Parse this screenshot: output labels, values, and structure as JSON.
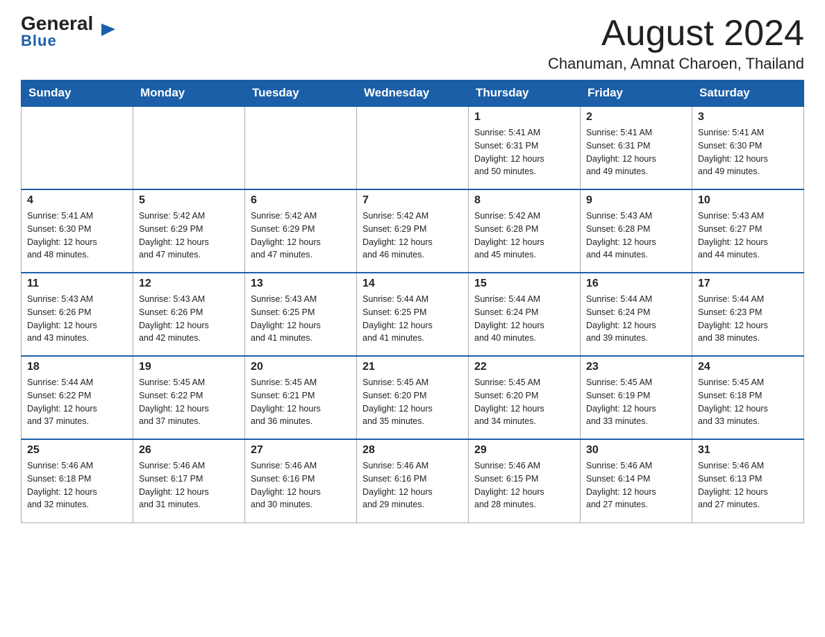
{
  "header": {
    "logo_general": "General",
    "logo_blue": "Blue",
    "month_title": "August 2024",
    "location": "Chanuman, Amnat Charoen, Thailand"
  },
  "days_of_week": [
    "Sunday",
    "Monday",
    "Tuesday",
    "Wednesday",
    "Thursday",
    "Friday",
    "Saturday"
  ],
  "weeks": [
    {
      "days": [
        {
          "date": "",
          "info": ""
        },
        {
          "date": "",
          "info": ""
        },
        {
          "date": "",
          "info": ""
        },
        {
          "date": "",
          "info": ""
        },
        {
          "date": "1",
          "info": "Sunrise: 5:41 AM\nSunset: 6:31 PM\nDaylight: 12 hours\nand 50 minutes."
        },
        {
          "date": "2",
          "info": "Sunrise: 5:41 AM\nSunset: 6:31 PM\nDaylight: 12 hours\nand 49 minutes."
        },
        {
          "date": "3",
          "info": "Sunrise: 5:41 AM\nSunset: 6:30 PM\nDaylight: 12 hours\nand 49 minutes."
        }
      ]
    },
    {
      "days": [
        {
          "date": "4",
          "info": "Sunrise: 5:41 AM\nSunset: 6:30 PM\nDaylight: 12 hours\nand 48 minutes."
        },
        {
          "date": "5",
          "info": "Sunrise: 5:42 AM\nSunset: 6:29 PM\nDaylight: 12 hours\nand 47 minutes."
        },
        {
          "date": "6",
          "info": "Sunrise: 5:42 AM\nSunset: 6:29 PM\nDaylight: 12 hours\nand 47 minutes."
        },
        {
          "date": "7",
          "info": "Sunrise: 5:42 AM\nSunset: 6:29 PM\nDaylight: 12 hours\nand 46 minutes."
        },
        {
          "date": "8",
          "info": "Sunrise: 5:42 AM\nSunset: 6:28 PM\nDaylight: 12 hours\nand 45 minutes."
        },
        {
          "date": "9",
          "info": "Sunrise: 5:43 AM\nSunset: 6:28 PM\nDaylight: 12 hours\nand 44 minutes."
        },
        {
          "date": "10",
          "info": "Sunrise: 5:43 AM\nSunset: 6:27 PM\nDaylight: 12 hours\nand 44 minutes."
        }
      ]
    },
    {
      "days": [
        {
          "date": "11",
          "info": "Sunrise: 5:43 AM\nSunset: 6:26 PM\nDaylight: 12 hours\nand 43 minutes."
        },
        {
          "date": "12",
          "info": "Sunrise: 5:43 AM\nSunset: 6:26 PM\nDaylight: 12 hours\nand 42 minutes."
        },
        {
          "date": "13",
          "info": "Sunrise: 5:43 AM\nSunset: 6:25 PM\nDaylight: 12 hours\nand 41 minutes."
        },
        {
          "date": "14",
          "info": "Sunrise: 5:44 AM\nSunset: 6:25 PM\nDaylight: 12 hours\nand 41 minutes."
        },
        {
          "date": "15",
          "info": "Sunrise: 5:44 AM\nSunset: 6:24 PM\nDaylight: 12 hours\nand 40 minutes."
        },
        {
          "date": "16",
          "info": "Sunrise: 5:44 AM\nSunset: 6:24 PM\nDaylight: 12 hours\nand 39 minutes."
        },
        {
          "date": "17",
          "info": "Sunrise: 5:44 AM\nSunset: 6:23 PM\nDaylight: 12 hours\nand 38 minutes."
        }
      ]
    },
    {
      "days": [
        {
          "date": "18",
          "info": "Sunrise: 5:44 AM\nSunset: 6:22 PM\nDaylight: 12 hours\nand 37 minutes."
        },
        {
          "date": "19",
          "info": "Sunrise: 5:45 AM\nSunset: 6:22 PM\nDaylight: 12 hours\nand 37 minutes."
        },
        {
          "date": "20",
          "info": "Sunrise: 5:45 AM\nSunset: 6:21 PM\nDaylight: 12 hours\nand 36 minutes."
        },
        {
          "date": "21",
          "info": "Sunrise: 5:45 AM\nSunset: 6:20 PM\nDaylight: 12 hours\nand 35 minutes."
        },
        {
          "date": "22",
          "info": "Sunrise: 5:45 AM\nSunset: 6:20 PM\nDaylight: 12 hours\nand 34 minutes."
        },
        {
          "date": "23",
          "info": "Sunrise: 5:45 AM\nSunset: 6:19 PM\nDaylight: 12 hours\nand 33 minutes."
        },
        {
          "date": "24",
          "info": "Sunrise: 5:45 AM\nSunset: 6:18 PM\nDaylight: 12 hours\nand 33 minutes."
        }
      ]
    },
    {
      "days": [
        {
          "date": "25",
          "info": "Sunrise: 5:46 AM\nSunset: 6:18 PM\nDaylight: 12 hours\nand 32 minutes."
        },
        {
          "date": "26",
          "info": "Sunrise: 5:46 AM\nSunset: 6:17 PM\nDaylight: 12 hours\nand 31 minutes."
        },
        {
          "date": "27",
          "info": "Sunrise: 5:46 AM\nSunset: 6:16 PM\nDaylight: 12 hours\nand 30 minutes."
        },
        {
          "date": "28",
          "info": "Sunrise: 5:46 AM\nSunset: 6:16 PM\nDaylight: 12 hours\nand 29 minutes."
        },
        {
          "date": "29",
          "info": "Sunrise: 5:46 AM\nSunset: 6:15 PM\nDaylight: 12 hours\nand 28 minutes."
        },
        {
          "date": "30",
          "info": "Sunrise: 5:46 AM\nSunset: 6:14 PM\nDaylight: 12 hours\nand 27 minutes."
        },
        {
          "date": "31",
          "info": "Sunrise: 5:46 AM\nSunset: 6:13 PM\nDaylight: 12 hours\nand 27 minutes."
        }
      ]
    }
  ]
}
